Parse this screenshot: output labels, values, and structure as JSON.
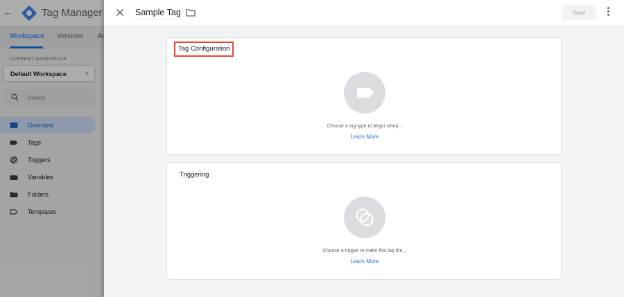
{
  "app": {
    "title": "Tag Manager",
    "tabs": [
      {
        "label": "Workspace"
      },
      {
        "label": "Versions"
      },
      {
        "label": "Ac"
      }
    ]
  },
  "sidebar": {
    "workspace_label": "CURRENT WORKSPACE",
    "workspace_name": "Default Workspace",
    "search_placeholder": "Search",
    "items": [
      {
        "label": "Overview",
        "icon": "overview-icon"
      },
      {
        "label": "Tags",
        "icon": "tag-icon"
      },
      {
        "label": "Triggers",
        "icon": "trigger-icon"
      },
      {
        "label": "Variables",
        "icon": "variables-icon"
      },
      {
        "label": "Folders",
        "icon": "folder-icon"
      },
      {
        "label": "Templates",
        "icon": "template-icon"
      }
    ]
  },
  "editor": {
    "tag_name": "Sample Tag",
    "save_label": "Save",
    "tag_config": {
      "title": "Tag Configuration",
      "hint": "Choose a tag type to begin setup...",
      "link": "Learn More"
    },
    "triggering": {
      "title": "Triggering",
      "hint": "Choose a trigger to make this tag fire...",
      "link": "Learn More"
    }
  },
  "colors": {
    "accent": "#1a73e8",
    "highlight": "#e8452f",
    "active_nav_bg": "#d2e3fc"
  }
}
